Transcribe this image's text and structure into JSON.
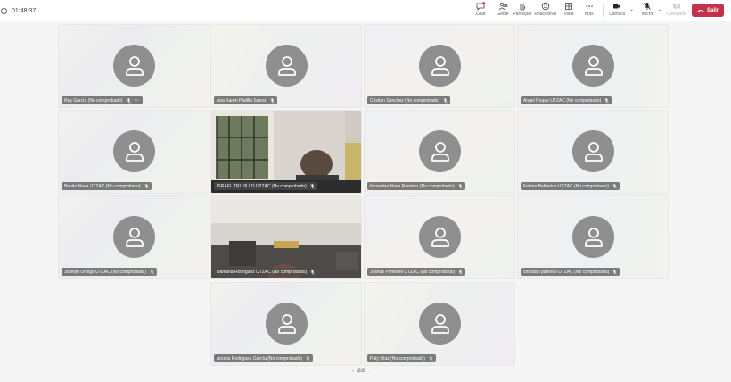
{
  "header": {
    "timer": "01:48:37",
    "controls": {
      "chat": "Chat",
      "people": "Gente",
      "people_count": "38",
      "raise": "Participar",
      "react": "Reaccionar",
      "view": "Vista",
      "more": "Más",
      "camera": "Cámara",
      "mic": "Micro",
      "share": "Compartir"
    },
    "leave": "Salir"
  },
  "participants": [
    {
      "name": "Roy García (No comprobado)",
      "muted": true,
      "more": true
    },
    {
      "name": "Ana Karen Padilla Saenz",
      "muted": true
    },
    {
      "name": "Cristian Sánchez (No comprobado)",
      "muted": true
    },
    {
      "name": "Angel Roque UTZAC (No comprobado)",
      "muted": true
    },
    {
      "name": "Benito Nava UTZAC (No comprobado)",
      "muted": true
    },
    {
      "name": "ISRAEL TRUJILLO UTZAC (No comprobado)",
      "muted": true,
      "video": true
    },
    {
      "name": "Itsoseline Nava Ramírez (No comprobado)",
      "muted": true
    },
    {
      "name": "Fatima Balbarios UTZAC (No comprobado)",
      "muted": true
    },
    {
      "name": "Joselyn Ortega UTZAC (No comprobado)",
      "muted": true
    },
    {
      "name": "Daniana Rodriguez UTZAC (No comprobado)",
      "muted": true,
      "video": true
    },
    {
      "name": "Joshue Pimentel UTZAC (No comprobado)",
      "muted": true
    },
    {
      "name": "christian pateños UTZAC (No comprobado)",
      "muted": true
    },
    {
      "name": "Arcelia Rodriguez García (No comprobado)",
      "muted": true
    },
    {
      "name": "Paty Díaz (No comprobado)",
      "muted": true
    }
  ],
  "pager": {
    "label": "2/2"
  },
  "colors": {
    "leave": "#c4314b",
    "avatar": "#8f8f8f"
  }
}
